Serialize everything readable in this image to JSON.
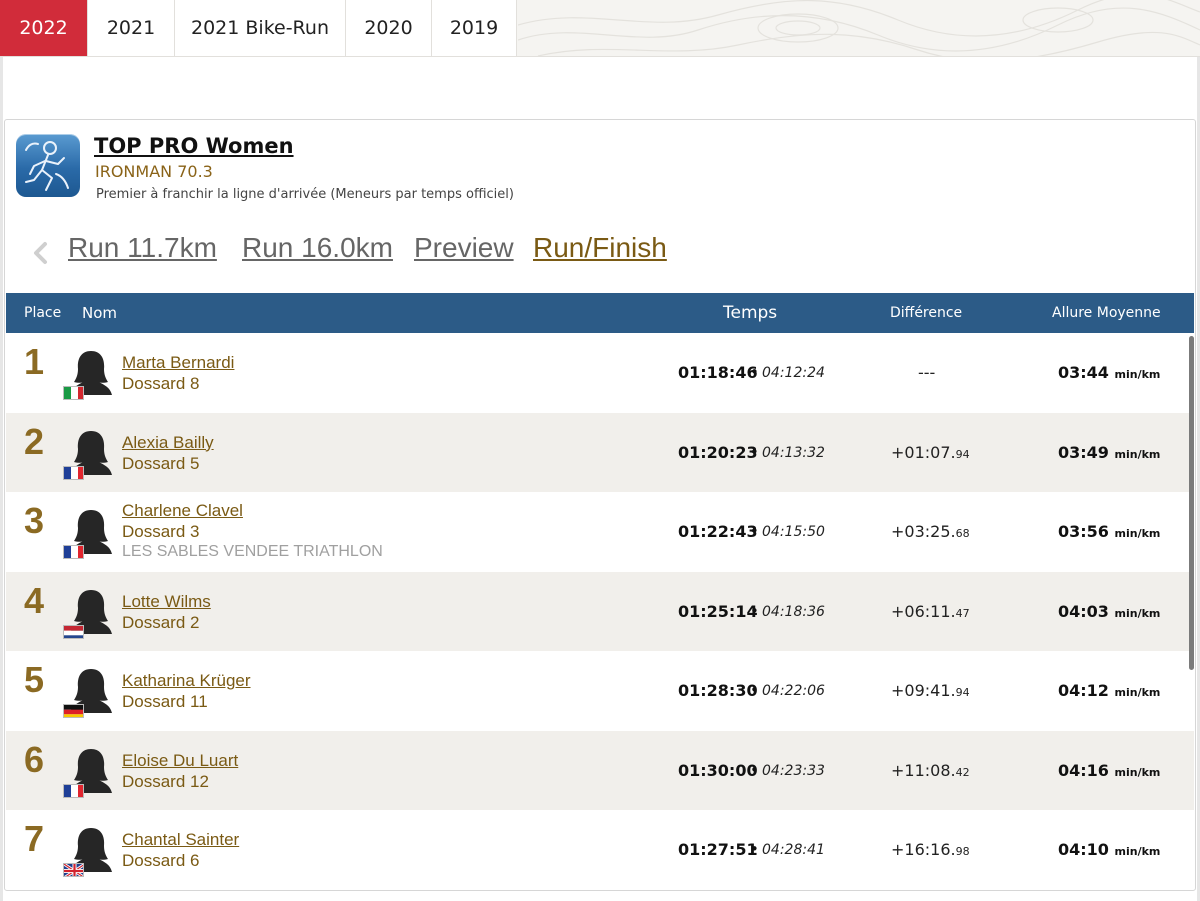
{
  "year_tabs": [
    {
      "label": "2022",
      "active": true
    },
    {
      "label": "2021",
      "active": false
    },
    {
      "label": "2021 Bike-Run",
      "active": false
    },
    {
      "label": "2020",
      "active": false
    },
    {
      "label": "2019",
      "active": false
    }
  ],
  "header": {
    "title": "TOP PRO Women",
    "subtitle": "IRONMAN 70.3",
    "description": "Premier à franchir la ligne d'arrivée (Meneurs par temps officiel)",
    "logo_icon": "runner-logo-icon"
  },
  "splits": {
    "prev_icon": "chevron-left-icon",
    "items": [
      {
        "label": "Run 11.7km",
        "active": false
      },
      {
        "label": "Run 16.0km",
        "active": false
      },
      {
        "label": "Preview",
        "active": false
      },
      {
        "label": "Run/Finish",
        "active": true
      }
    ]
  },
  "table": {
    "columns": {
      "place": "Place",
      "nom": "Nom",
      "temps": "Temps",
      "difference": "Différence",
      "allure": "Allure Moyenne"
    },
    "pace_unit": "min/km",
    "time_separator": "•",
    "rows": [
      {
        "place": "1",
        "name": "Marta Bernardi",
        "bib": "Dossard 8",
        "club": "",
        "country": "IT",
        "flag": "italy-flag-icon",
        "split": "01:18:46",
        "overall": "04:12:24",
        "diff_main": "---",
        "diff_ms": "",
        "pace": "03:44"
      },
      {
        "place": "2",
        "name": "Alexia Bailly",
        "bib": "Dossard 5",
        "club": "",
        "country": "FR",
        "flag": "france-flag-icon",
        "split": "01:20:23",
        "overall": "04:13:32",
        "diff_main": "+01:07.",
        "diff_ms": "94",
        "pace": "03:49"
      },
      {
        "place": "3",
        "name": "Charlene Clavel",
        "bib": "Dossard 3",
        "club": "LES SABLES VENDEE TRIATHLON",
        "country": "FR",
        "flag": "france-flag-icon",
        "split": "01:22:43",
        "overall": "04:15:50",
        "diff_main": "+03:25.",
        "diff_ms": "68",
        "pace": "03:56"
      },
      {
        "place": "4",
        "name": "Lotte Wilms",
        "bib": "Dossard 2",
        "club": "",
        "country": "NL",
        "flag": "netherlands-flag-icon",
        "split": "01:25:14",
        "overall": "04:18:36",
        "diff_main": "+06:11.",
        "diff_ms": "47",
        "pace": "04:03"
      },
      {
        "place": "5",
        "name": "Katharina Krüger",
        "bib": "Dossard 11",
        "club": "",
        "country": "DE",
        "flag": "germany-flag-icon",
        "split": "01:28:30",
        "overall": "04:22:06",
        "diff_main": "+09:41.",
        "diff_ms": "94",
        "pace": "04:12"
      },
      {
        "place": "6",
        "name": "Eloise Du Luart",
        "bib": "Dossard 12",
        "club": "",
        "country": "FR",
        "flag": "france-flag-icon",
        "split": "01:30:00",
        "overall": "04:23:33",
        "diff_main": "+11:08.",
        "diff_ms": "42",
        "pace": "04:16"
      },
      {
        "place": "7",
        "name": "Chantal Sainter",
        "bib": "Dossard 6",
        "club": "",
        "country": "GB",
        "flag": "uk-flag-icon",
        "split": "01:27:51",
        "overall": "04:28:41",
        "diff_main": "+16:16.",
        "diff_ms": "98",
        "pace": "04:10"
      }
    ]
  },
  "colors": {
    "active_tab": "#d12c3a",
    "table_header": "#2c5b87",
    "accent_gold": "#8b6a23",
    "link_brown": "#7a5a14",
    "alt_row": "#f1efeb"
  }
}
